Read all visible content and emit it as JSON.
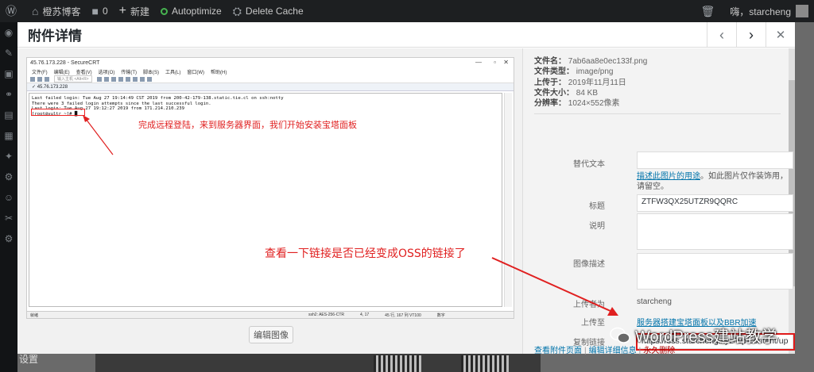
{
  "adminbar": {
    "site_name": "橙苏博客",
    "comments_count": "0",
    "new_label": "新建",
    "autoptimize_label": "Autoptimize",
    "delete_cache_label": "Delete Cache",
    "greeting": "嗨，starcheng"
  },
  "sidebar": {
    "settings_label": "设置",
    "partial_label": "媒体"
  },
  "modal": {
    "title": "附件详情",
    "prev_icon": "chevron-left-icon",
    "next_icon": "chevron-right-icon",
    "close_icon": "close-icon",
    "edit_image_label": "编辑图像"
  },
  "screenshot": {
    "window_title": "45.76.173.228 - SecureCRT",
    "menu": [
      "文件(F)",
      "编辑(E)",
      "查看(V)",
      "选项(O)",
      "传输(T)",
      "脚本(S)",
      "工具(L)",
      "窗口(W)",
      "帮助(H)"
    ],
    "toolbar_hint": "输入主机 <Alt+R>",
    "tab_label": "✓ 45.76.173.228",
    "terminal_lines": [
      "Last failed login: Tue Aug 27 19:14:49 CST 2019 from 200-42-179-138.static.tie.cl on ssh:notty",
      "There were 3 failed login attempts since the last successful login.",
      "Last login: Tue Aug 27 19:12:27 2019 from 171.214.210.239",
      "[root@vultr ~]# █"
    ],
    "status_left": "就绪",
    "status_right": [
      "ssh2: AES-256-CTR",
      "4, 17",
      "45 行, 167 列 VT100",
      "数字"
    ],
    "annotation_1": "完成远程登陆，来到服务器界面，我们开始安装宝塔面板",
    "annotation_2": "查看一下链接是否已经变成OSS的链接了"
  },
  "file_info": {
    "filename_label": "文件名：",
    "filename": "7ab6aa8e0ec133f.png",
    "filetype_label": "文件类型：",
    "filetype": "image/png",
    "uploaded_label": "上传于：",
    "uploaded": "2019年11月11日",
    "filesize_label": "文件大小：",
    "filesize": "84 KB",
    "dimensions_label": "分辨率：",
    "dimensions": "1024×552像素"
  },
  "fields": {
    "alt_label": "替代文本",
    "alt_value": "",
    "alt_help_link": "描述此图片的用途",
    "alt_help_text": "。如此图片仅作装饰用，请留空。",
    "title_label": "标题",
    "title_value": "ZTFW3QX25UTZR9QQRC",
    "caption_label": "说明",
    "caption_value": "",
    "description_label": "图像描述",
    "description_value": "",
    "uploaded_by_label": "上传者为",
    "uploaded_by": "starcheng",
    "uploaded_to_label": "上传至",
    "uploaded_to": "服务器搭建宝塔面板以及BBR加速",
    "copy_link_label": "复制链接",
    "copy_link_value": "https://oss.starcheng.xyz/wp-content/up"
  },
  "actions": {
    "view_page": "查看附件页面",
    "edit_more": "编辑详细信息",
    "delete": "永久删除",
    "separator": "|"
  },
  "watermark": {
    "text": "WordPress建站教学"
  },
  "colors": {
    "annotation_red": "#e02020",
    "link_blue": "#0073aa",
    "delete_red": "#a00000",
    "adminbar_bg": "#1d1f21"
  }
}
